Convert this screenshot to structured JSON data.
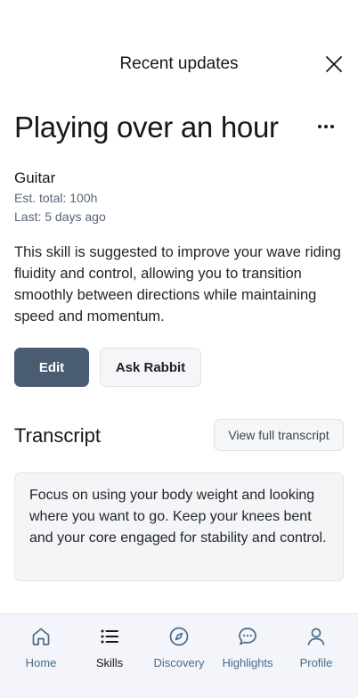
{
  "header": {
    "title": "Recent updates"
  },
  "skill": {
    "title": "Playing over an hour",
    "name": "Guitar",
    "est_total": "Est. total: 100h",
    "last": "Last: 5 days ago",
    "description": "This skill is suggested to improve your wave riding fluidity and control, allowing you to transition smoothly between directions while maintaining speed and momentum."
  },
  "actions": {
    "edit_label": "Edit",
    "ask_label": "Ask Rabbit"
  },
  "transcript": {
    "title": "Transcript",
    "view_full_label": "View full transcript",
    "text": "Focus on using your body weight and looking where you want to go. Keep your knees bent and your core engaged for stability and control."
  },
  "tabs": [
    {
      "label": "Home",
      "icon": "home-icon"
    },
    {
      "label": "Skills",
      "icon": "list-icon",
      "active": true
    },
    {
      "label": "Discovery",
      "icon": "compass-icon"
    },
    {
      "label": "Highlights",
      "icon": "chat-bubble-icon"
    },
    {
      "label": "Profile",
      "icon": "user-icon"
    }
  ],
  "colors": {
    "accent": "#4a5c72",
    "tab_inactive": "#4a6a86",
    "tab_bar_bg": "#f3f5fa"
  }
}
